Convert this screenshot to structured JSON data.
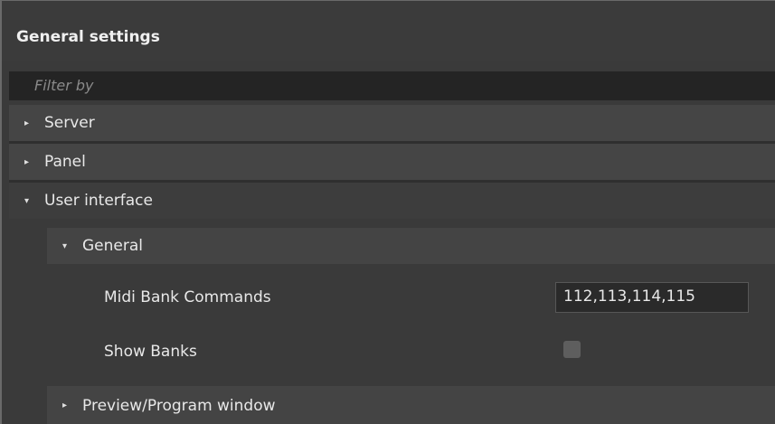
{
  "header": {
    "title": "General settings"
  },
  "filter": {
    "placeholder": "Filter by"
  },
  "sections": [
    {
      "label": "Server",
      "expanded": false,
      "arrow": "▸"
    },
    {
      "label": "Panel",
      "expanded": false,
      "arrow": "▸"
    },
    {
      "label": "User interface",
      "expanded": true,
      "arrow": "▾"
    }
  ],
  "subsections": [
    {
      "label": "General",
      "expanded": true,
      "arrow": "▾"
    },
    {
      "label": "Preview/Program window",
      "expanded": false,
      "arrow": "▸"
    }
  ],
  "settings": {
    "midi_bank_commands": {
      "label": "Midi Bank Commands",
      "value": "112,113,114,115"
    },
    "show_banks": {
      "label": "Show Banks",
      "checked": false
    }
  }
}
